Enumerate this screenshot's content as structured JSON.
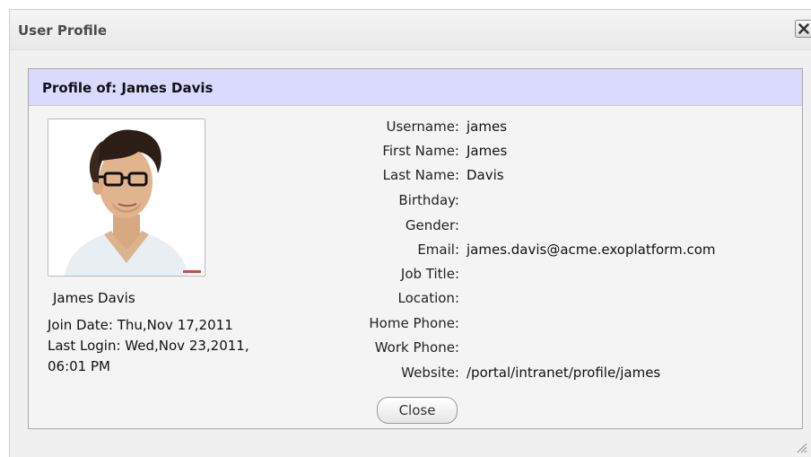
{
  "window": {
    "title": "User Profile"
  },
  "profile": {
    "header": "Profile of: James Davis",
    "display_name": "James Davis",
    "join_date": "Join Date: Thu,Nov 17,2011",
    "last_login_line1": "Last Login: Wed,Nov 23,2011,",
    "last_login_line2": "06:01 PM",
    "fields": [
      {
        "label": "Username:",
        "value": "james"
      },
      {
        "label": "First Name:",
        "value": "James"
      },
      {
        "label": "Last Name:",
        "value": "Davis"
      },
      {
        "label": "Birthday:",
        "value": ""
      },
      {
        "label": "Gender:",
        "value": ""
      },
      {
        "label": "Email:",
        "value": "james.davis@acme.exoplatform.com"
      },
      {
        "label": "Job Title:",
        "value": ""
      },
      {
        "label": "Location:",
        "value": ""
      },
      {
        "label": "Home Phone:",
        "value": ""
      },
      {
        "label": "Work Phone:",
        "value": ""
      },
      {
        "label": "Website:",
        "value": "/portal/intranet/profile/james"
      }
    ]
  },
  "buttons": {
    "close_label": "Close"
  },
  "icons": {
    "window_close": "close-icon",
    "resize": "resize-grip-icon",
    "avatar": "avatar-photo"
  },
  "colors": {
    "panel_header_bg": "#dadaff",
    "window_bg": "#f0f0f0"
  }
}
